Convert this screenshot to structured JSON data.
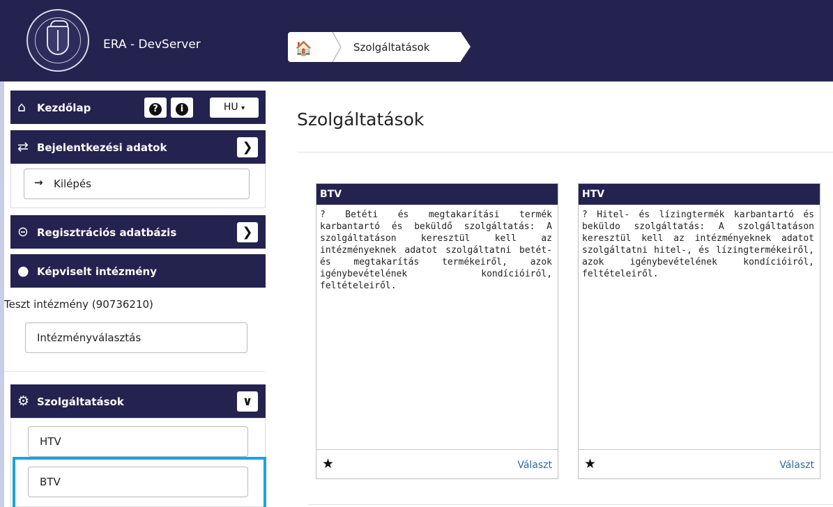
{
  "app": {
    "title": "ERA - DevServer"
  },
  "breadcrumb": {
    "home_icon": "home-icon",
    "current": "Szolgáltatások"
  },
  "sidebar": {
    "home_label": "Kezdőlap",
    "language": "HU",
    "login_data_label": "Bejelentkezési adatok",
    "logout_label": "Kilépés",
    "registry_label": "Regisztrációs adatbázis",
    "represented_label": "Képviselt intézmény",
    "institution": "Teszt intézmény (90736210)",
    "institution_select_label": "Intézményválasztás",
    "services_label": "Szolgáltatások",
    "service_items": [
      "HTV",
      "BTV"
    ]
  },
  "main": {
    "title": "Szolgáltatások",
    "cards": [
      {
        "header": "BTV",
        "description": "? Betéti és megtakarítási termék karbantartó és beküldő szolgáltatás: A szolgáltatáson keresztül kell az intézményeknek adatot szolgáltatni betét- és megtakarítás termékeiről, azok igénybevételének kondícióiról, feltételeiről.",
        "action": "Választ"
      },
      {
        "header": "HTV",
        "description": "? Hitel- és lízingtermék karbantartó és beküldo szolgáltatás: A szolgáltatáson keresztül kell az intézményeknek adatot szolgáltatni hitel-, és lízingtermékeiről, azok igénybevételének kondícióiról, feltételeiről.",
        "action": "Választ"
      }
    ]
  },
  "colors": {
    "nav": "#24224f",
    "highlight": "#1aa3e0",
    "link": "#2d6aa0"
  }
}
